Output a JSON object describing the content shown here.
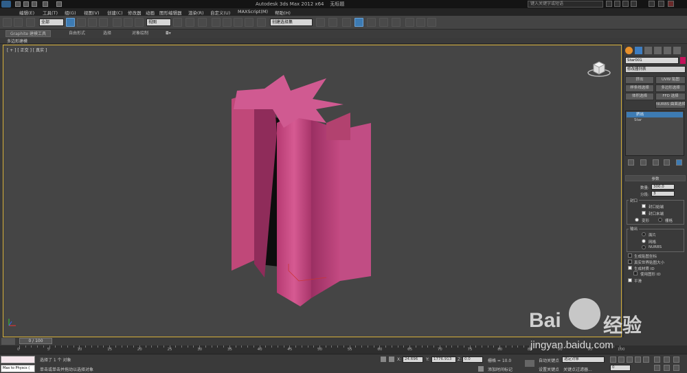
{
  "title": {
    "app": "Autodesk 3ds Max  2012 x64",
    "doc": "无标题",
    "search_placeholder": "键入关键字或短语"
  },
  "menu": [
    "编辑(E)",
    "工具(T)",
    "组(G)",
    "视图(V)",
    "创建(C)",
    "修改器",
    "动画",
    "图形编辑器",
    "渲染(R)",
    "自定义(U)",
    "MAXScript(M)",
    "帮助(H)"
  ],
  "toolbar": {
    "filter_value": "全部",
    "refcoord_value": "视图",
    "named_selection": "创建选择集"
  },
  "ribbon": {
    "tabs": [
      "Graphite 建模工具",
      "自由形式",
      "选择",
      "对象绘制"
    ],
    "panel_label": "多边形建模"
  },
  "viewport": {
    "label": "[ + ] [ 正交 ] [ 真实 ]",
    "object_color": "#c9467f",
    "frame_color": "#d8b23a"
  },
  "command_panel": {
    "object_name": "Star001",
    "object_color": "#c4125a",
    "modifier_list": "修改器列表",
    "buttons": [
      "挤出",
      "UVW 贴图",
      "样条线选择",
      "多边形选择",
      "体积选择",
      "FFD 选择",
      "NURBS 曲面选择"
    ],
    "stack": [
      "挤出",
      "Star"
    ],
    "rollout_title": "参数",
    "amount_label": "数量:",
    "amount_value": "300.0",
    "segments_label": "分段:",
    "segments_value": "3",
    "capping_title": "封口",
    "cap_start": "封口始端",
    "cap_end": "封口末端",
    "morph": "变形",
    "grid": "栅格",
    "output_title": "输出",
    "patch": "面片",
    "mesh": "网格",
    "nurbs": "NURBS",
    "gen_map": "生成贴图坐标",
    "real_world": "真实世界贴图大小",
    "gen_mat": "生成材质 ID",
    "use_shape": "使用图形 ID",
    "smooth": "平滑"
  },
  "timeline": {
    "slider": "0 / 100",
    "ticks": [
      "0",
      "5",
      "10",
      "15",
      "20",
      "25",
      "30",
      "35",
      "40",
      "45",
      "50",
      "55",
      "60",
      "65",
      "70",
      "75",
      "80",
      "85",
      "90",
      "95",
      "100"
    ]
  },
  "status": {
    "maxscript": "Max to Physcs (",
    "selected": "选择了 1 个 对象",
    "prompt": "单击或单击并拖动以选择对象",
    "x_label": "X:",
    "x_value": "24.696",
    "y_label": "Y:",
    "y_value": "1776.913",
    "z_label": "Z:",
    "z_value": "0.0",
    "grid": "栅格 = 10.0",
    "add_time_tag": "添加时间标记",
    "auto_key": "自动关键点",
    "set_key": "设置关键点",
    "selected_obj": "选定对象",
    "key_filters": "关键点过滤器...",
    "frame": "0"
  },
  "watermark": {
    "brand": "Bai",
    "brand2": "经验",
    "url": "jingyan.baidu.com"
  }
}
